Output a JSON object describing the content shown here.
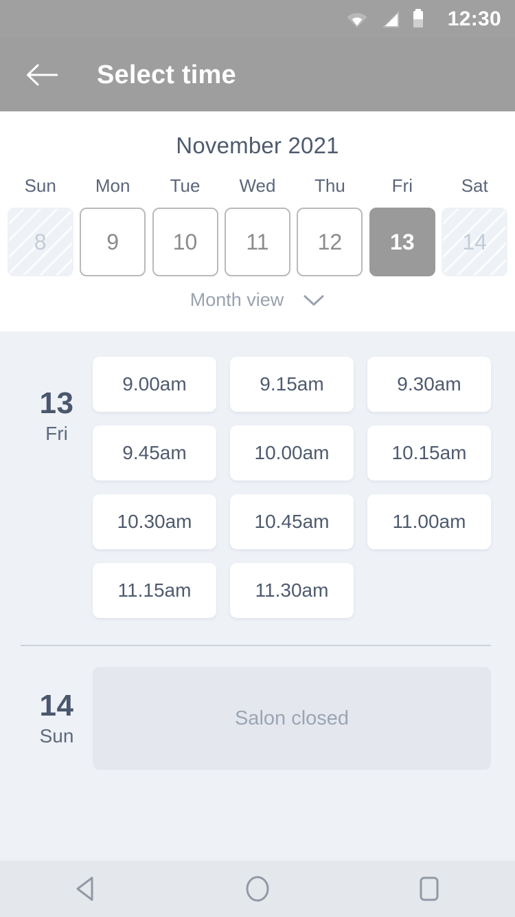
{
  "status_bar": {
    "time": "12:30",
    "icons": [
      "wifi-icon",
      "cellular-signal-icon",
      "battery-icon"
    ]
  },
  "app_bar": {
    "back_icon": "back-arrow-icon",
    "title": "Select time"
  },
  "calendar": {
    "month_title": "November 2021",
    "weekdays": [
      "Sun",
      "Mon",
      "Tue",
      "Wed",
      "Thu",
      "Fri",
      "Sat"
    ],
    "days": [
      {
        "num": "8",
        "state": "disabled"
      },
      {
        "num": "9",
        "state": "enabled"
      },
      {
        "num": "10",
        "state": "enabled"
      },
      {
        "num": "11",
        "state": "enabled"
      },
      {
        "num": "12",
        "state": "enabled"
      },
      {
        "num": "13",
        "state": "selected"
      },
      {
        "num": "14",
        "state": "disabled"
      }
    ],
    "view_toggle": {
      "label": "Month view",
      "icon": "chevron-down-icon"
    }
  },
  "schedule": {
    "groups": [
      {
        "day_number": "13",
        "day_name": "Fri",
        "slots": [
          "9.00am",
          "9.15am",
          "9.30am",
          "9.45am",
          "10.00am",
          "10.15am",
          "10.30am",
          "10.45am",
          "11.00am",
          "11.15am",
          "11.30am"
        ],
        "closed_message": null
      },
      {
        "day_number": "14",
        "day_name": "Sun",
        "slots": [],
        "closed_message": "Salon closed"
      }
    ]
  },
  "nav_bar": {
    "buttons": [
      {
        "name": "back-triangle-icon"
      },
      {
        "name": "home-circle-icon"
      },
      {
        "name": "recents-square-icon"
      }
    ]
  },
  "colors": {
    "app_bar": "#9e9e9e",
    "status_bar": "#a0a0a0",
    "body_background": "#eef1f6",
    "selected_day": "#9a9a9a",
    "text_primary": "#4e5a6e",
    "text_muted": "#9aa2ae",
    "closed_panel": "#e4e8ee",
    "nav_bar": "#e4e7ec"
  }
}
